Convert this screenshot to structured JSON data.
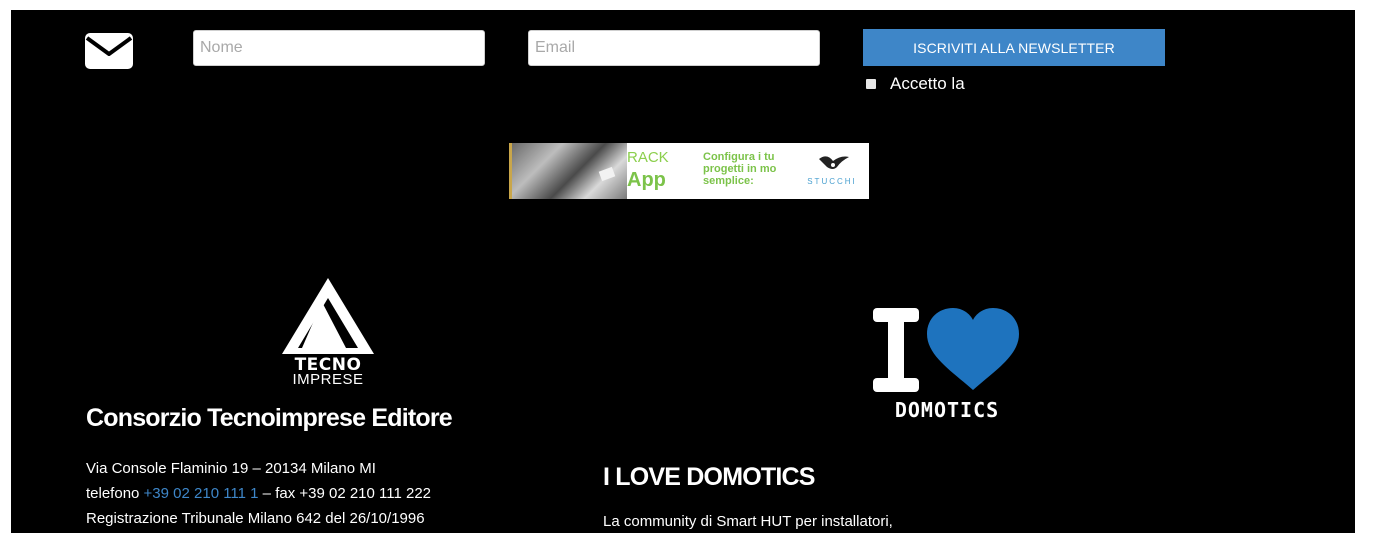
{
  "newsletter": {
    "mail_icon": "envelope-icon",
    "name_placeholder": "Nome",
    "name_value": "",
    "email_placeholder": "Email",
    "email_value": "",
    "subscribe_label": "ISCRIVITI ALLA NEWSLETTER",
    "consent_label": "Accetto la",
    "consent_checked": false
  },
  "banner": {
    "brand_top": "RACK",
    "brand_bottom": "App",
    "copy": "Configura i tu\nprogetti in mo\nsemplice:",
    "logo_text": "STUCCHI"
  },
  "company": {
    "logo_word": "TECNO",
    "logo_sub": "IMPRESE",
    "title": "Consorzio Tecnoimprese Editore",
    "address": "Via Console Flaminio 19 – 20134 Milano  MI",
    "phone_prefix": "telefono ",
    "phone": "+39 02 210 111 1",
    "fax": " – fax +39 02 210 111 222",
    "registration": "Registrazione Tribunale Milano 642 del 26/10/1996"
  },
  "domotics": {
    "logo_word": "DOMOTICS",
    "title": "I LOVE DOMOTICS",
    "text": "La community di Smart HUT per installatori,"
  },
  "colors": {
    "background": "#000000",
    "accent": "#3e86c8",
    "heart": "#1e73be",
    "text": "#ffffff"
  }
}
